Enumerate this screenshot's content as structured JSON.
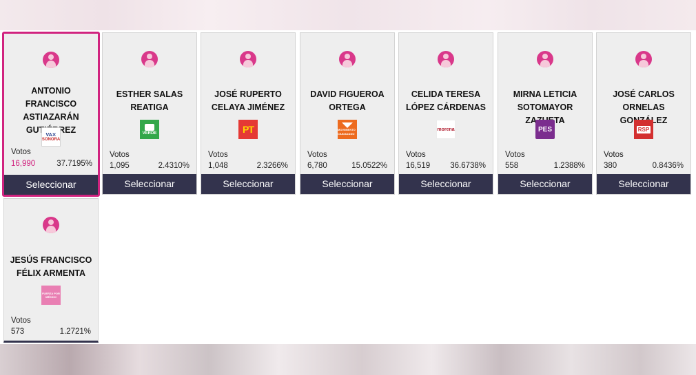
{
  "votes_label": "Votos",
  "select_label": "Seleccionar",
  "colors": {
    "accent": "#d1237f",
    "button": "#33334d",
    "card": "#eeeeee"
  },
  "candidates": [
    {
      "name": "ANTONIO FRANCISCO ASTIAZARÁN GUTIÉRREZ",
      "party_icon": "pan-logo",
      "party_text": "VA X SONORA",
      "votes": "16,990",
      "percent": "37.7195%",
      "selected": true
    },
    {
      "name": "ESTHER SALAS REATIGA",
      "party_icon": "pvem-logo",
      "party_text": "VERDE",
      "votes": "1,095",
      "percent": "2.4310%",
      "selected": false
    },
    {
      "name": "JOSÉ RUPERTO CELAYA JIMÉNEZ",
      "party_icon": "pt-logo",
      "party_text": "PT",
      "votes": "1,048",
      "percent": "2.3266%",
      "selected": false
    },
    {
      "name": "DAVID FIGUEROA ORTEGA",
      "party_icon": "movimiento-ciudadano-logo",
      "party_text": "MOVIMIENTO CIUDADANO",
      "votes": "6,780",
      "percent": "15.0522%",
      "selected": false
    },
    {
      "name": "CELIDA TERESA LÓPEZ CÁRDENAS",
      "party_icon": "morena-logo",
      "party_text": "morena",
      "votes": "16,519",
      "percent": "36.6738%",
      "selected": false
    },
    {
      "name": "MIRNA LETICIA SOTOMAYOR ZAZUETA",
      "party_icon": "pes-logo",
      "party_text": "PES",
      "votes": "558",
      "percent": "1.2388%",
      "selected": false
    },
    {
      "name": "JOSÉ CARLOS ORNELAS GONZÁLEZ",
      "party_icon": "rsp-logo",
      "party_text": "RSP",
      "votes": "380",
      "percent": "0.8436%",
      "selected": false
    },
    {
      "name": "JESÚS FRANCISCO FÉLIX ARMENTA",
      "party_icon": "fuerza-por-mexico-logo",
      "party_text": "FUERZA POR MÉXICO",
      "votes": "573",
      "percent": "1.2721%",
      "selected": false
    }
  ]
}
